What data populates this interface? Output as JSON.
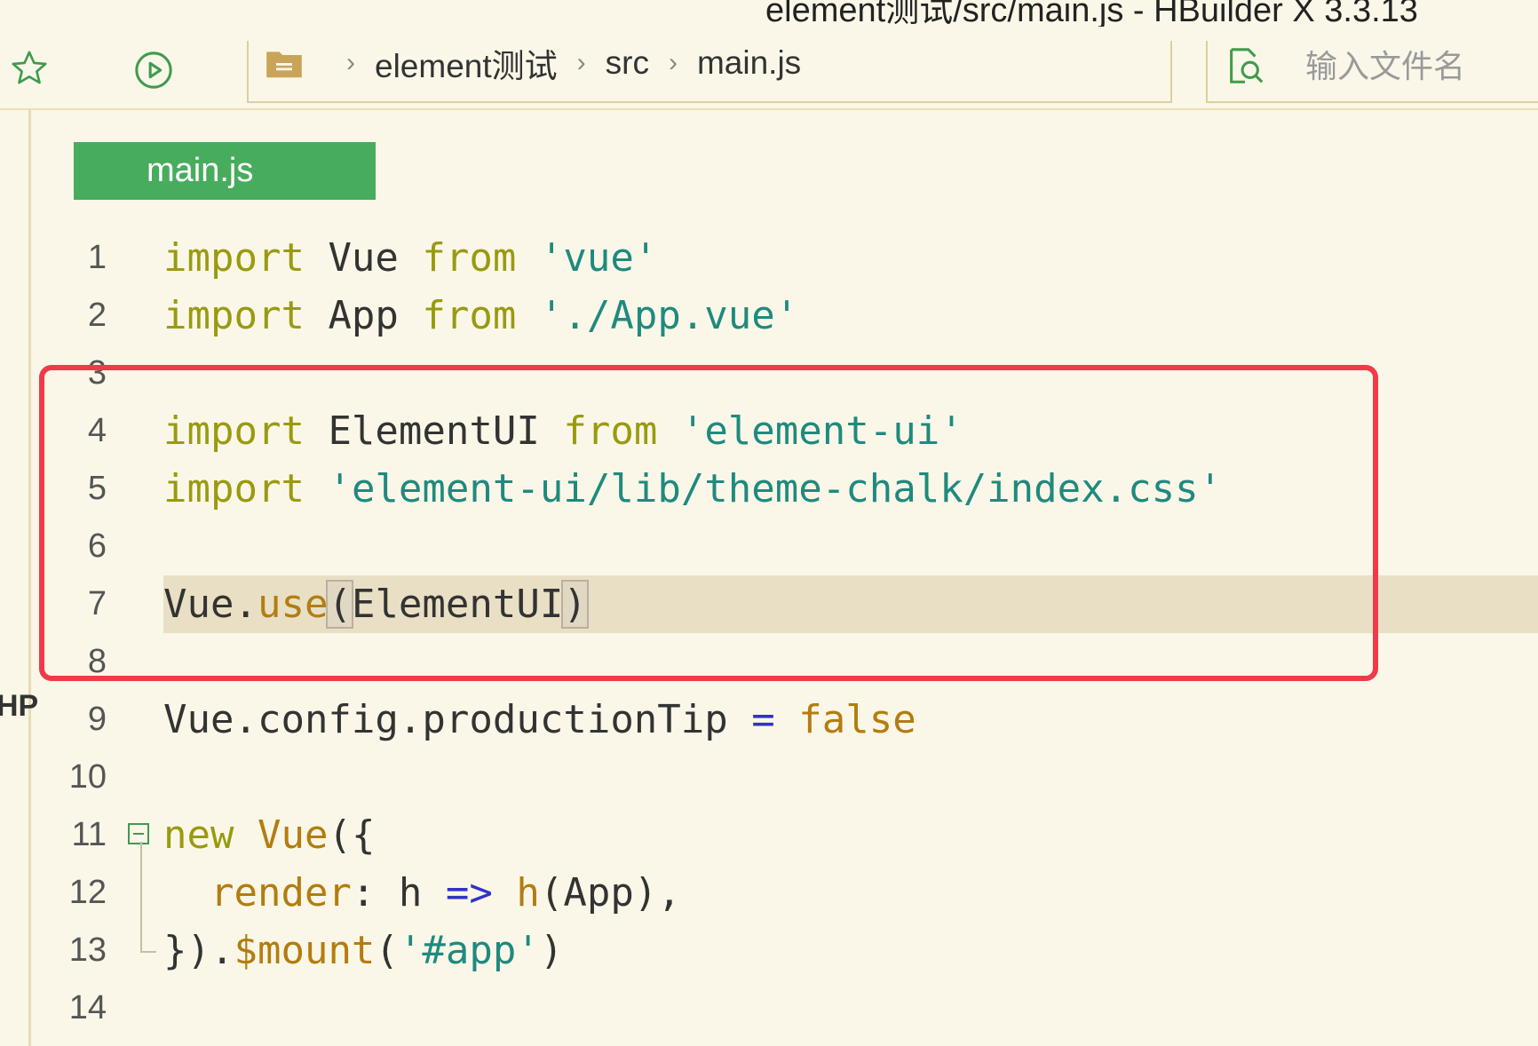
{
  "window": {
    "title": "element测试/src/main.js - HBuilder X 3.3.13"
  },
  "toolbar": {
    "breadcrumb": [
      "element测试",
      "src",
      "main.js"
    ],
    "file_search_placeholder": "输入文件名"
  },
  "left_strip_text": "HP",
  "tab": {
    "label": "main.js"
  },
  "code": {
    "line_numbers": [
      "1",
      "2",
      "3",
      "4",
      "5",
      "6",
      "7",
      "8",
      "9",
      "10",
      "11",
      "12",
      "13",
      "14"
    ]
  },
  "colors": {
    "background": "#fbf7e8",
    "tab_active": "#48ac5d",
    "highlight_box": "#f03a48",
    "keyword": "#9a9a10",
    "string": "#1f8a7e"
  }
}
